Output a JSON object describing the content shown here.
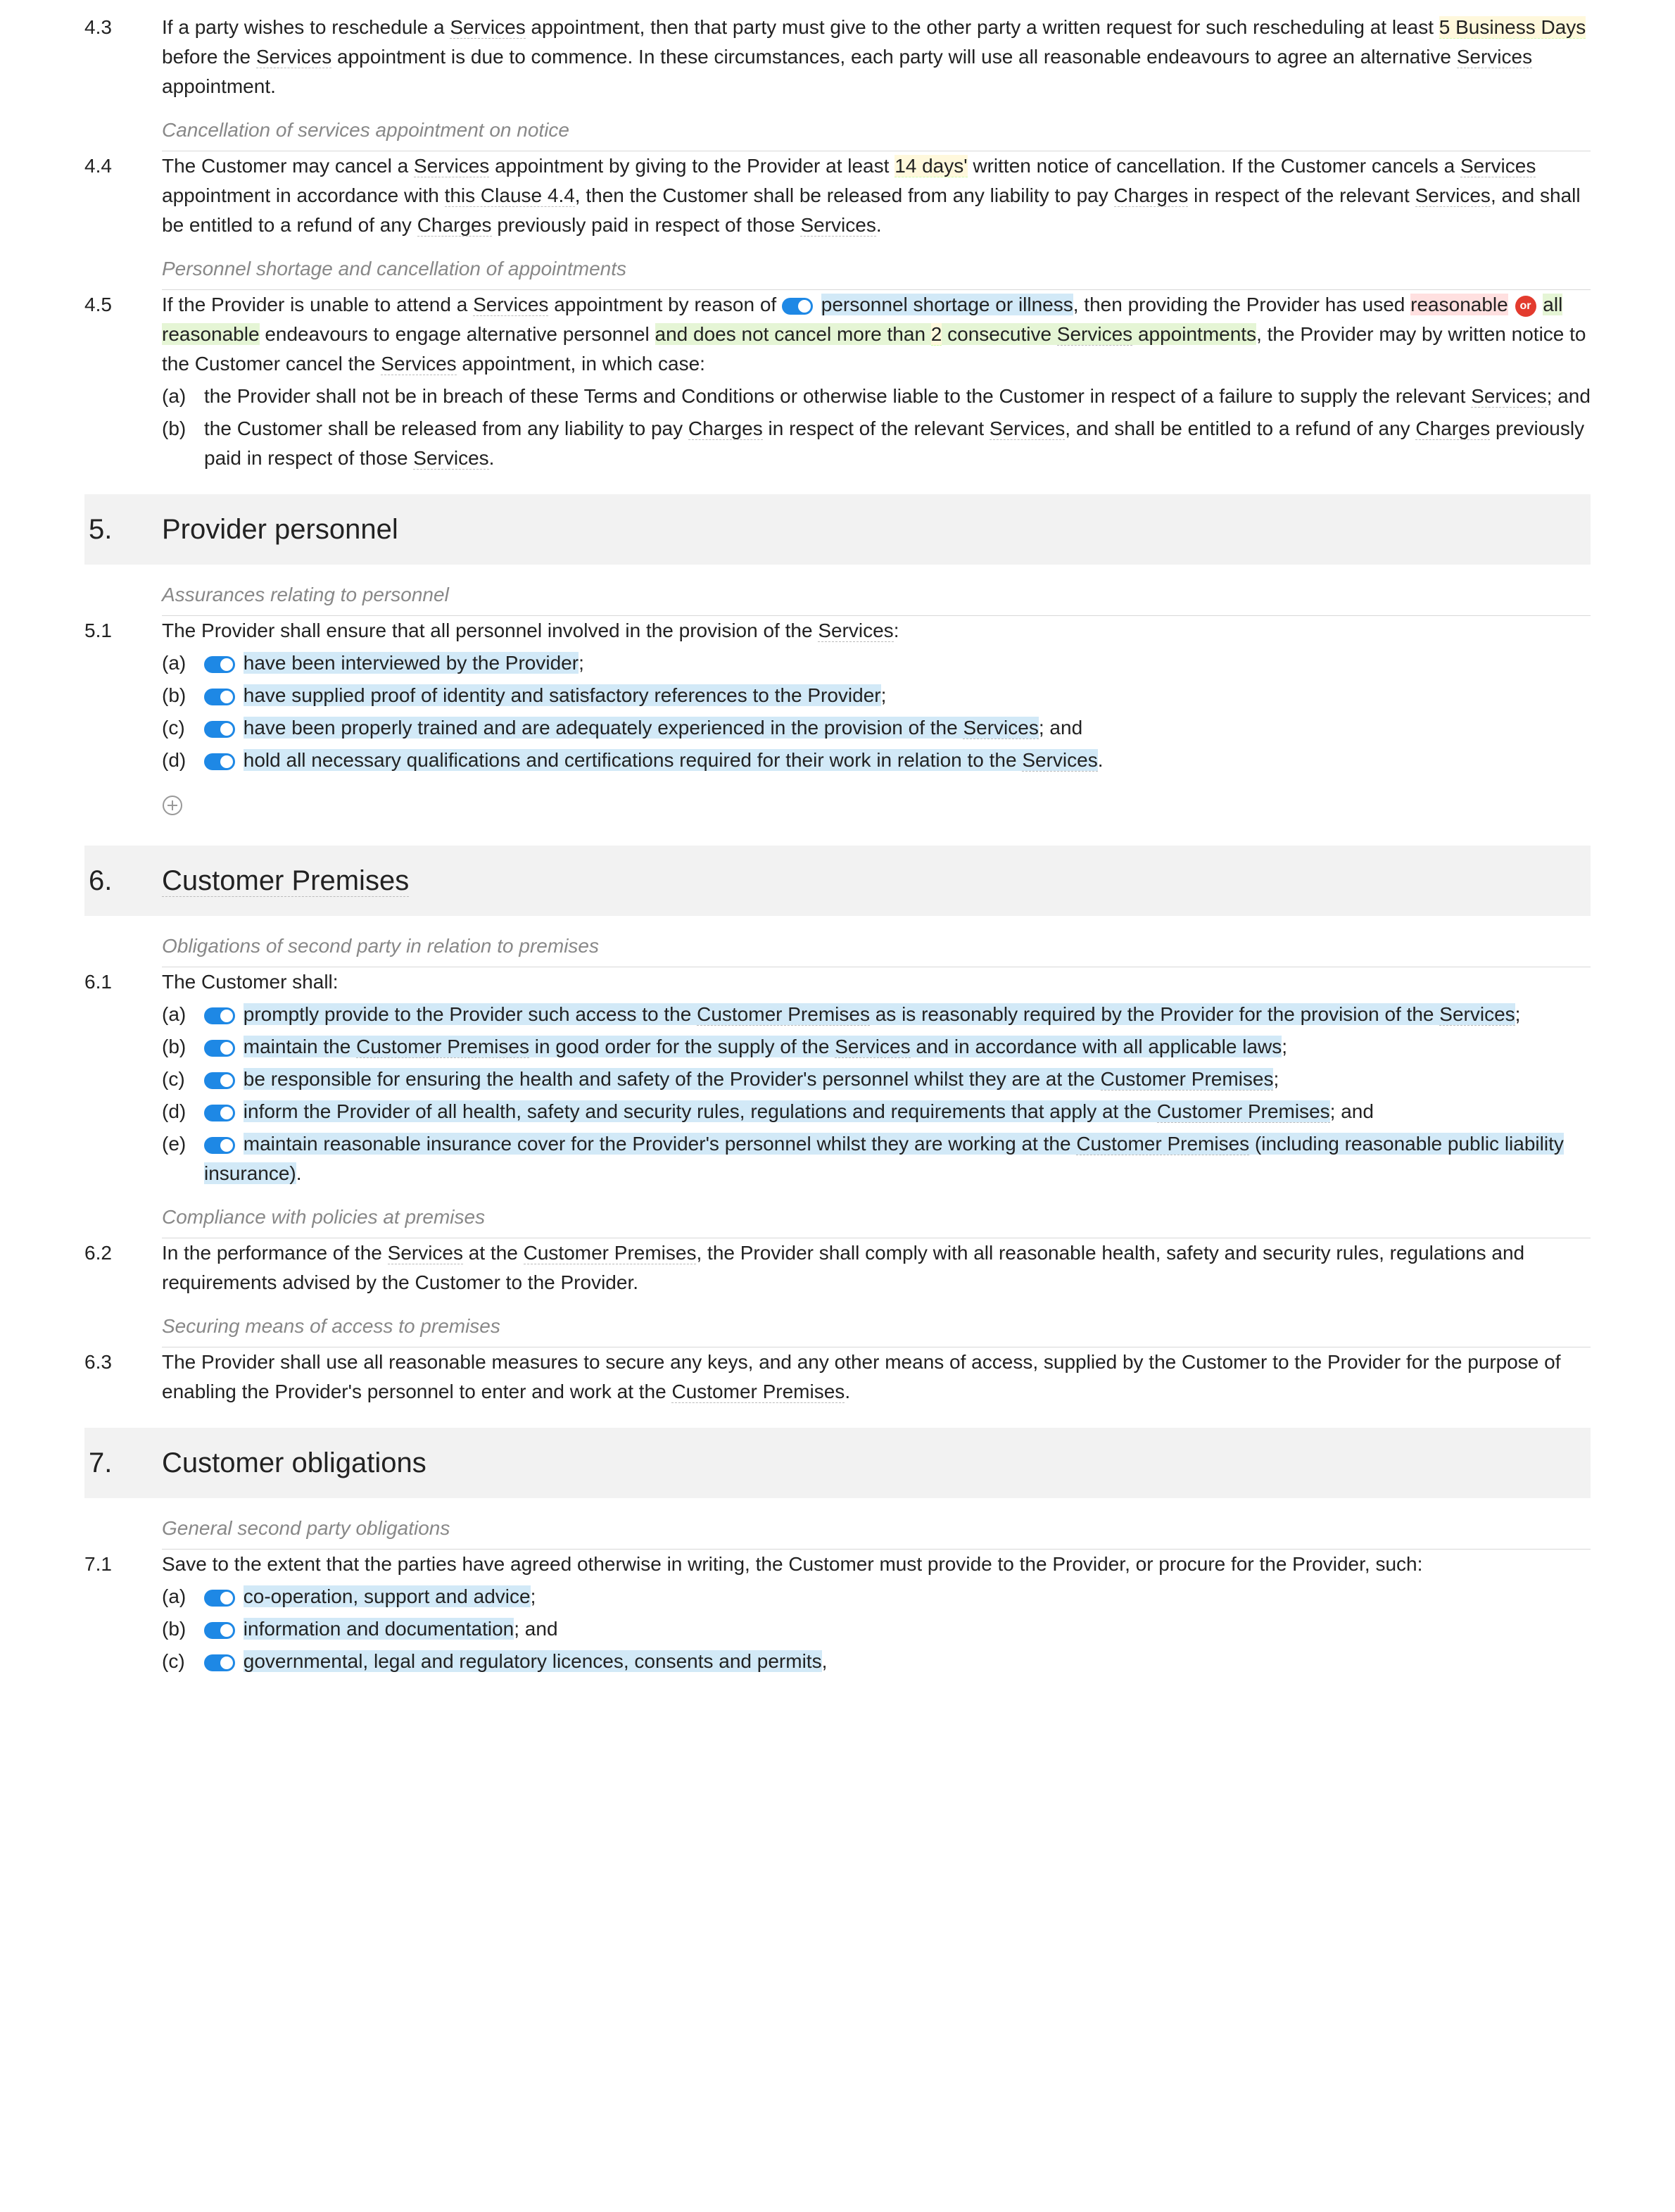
{
  "clauses": {
    "4_3": {
      "num": "4.3",
      "pre": "If a party wishes to reschedule a ",
      "def1": "Services",
      "mid1": " appointment, then that party must give to the other party a written request for such rescheduling at least ",
      "edit1": "5 Business Days",
      "mid2": " before the ",
      "def2": "Services",
      "mid3": " appointment is due to commence. In these circumstances, each party will use all reasonable endeavours to agree an alternative ",
      "def3": "Services",
      "post": " appointment."
    },
    "ann_4_3": "Cancellation of services appointment on notice",
    "4_4": {
      "num": "4.4",
      "t1": "The Customer may cancel a ",
      "d1": "Services",
      "t2": " appointment by giving to the Provider at least ",
      "e1": "14 days'",
      "t3": " written notice of cancellation. If the Customer cancels a ",
      "d2": "Services",
      "t4": " appointment in accordance with ",
      "d3": "this Clause 4.4",
      "t5": ", then the Customer shall be released from any liability to pay ",
      "d4": "Charges",
      "t6": " in respect of the relevant ",
      "d5": "Services",
      "t7": ", and shall be entitled to a refund of any ",
      "d6": "Charges",
      "t8": " previously paid in respect of those ",
      "d7": "Services",
      "t9": "."
    },
    "ann_4_4": "Personnel shortage and cancellation of appointments",
    "4_5": {
      "num": "4.5",
      "t1": "If the Provider is unable to attend a ",
      "d1": "Services",
      "t2": " appointment by reason of ",
      "tog1": "personnel shortage or illness",
      "t3": ", then providing the Provider has used ",
      "opt1a": "reasonable",
      "or": "or",
      "opt1b": "all reasonable",
      "t4": " endeavours to engage alternative personnel ",
      "opt2a": "and does not cancel more than ",
      "opt2b": "2",
      "opt2c": " consecutive ",
      "d2": "Services",
      "opt2d": " appointments",
      "t5": ", the Provider may by written notice to the Customer cancel the ",
      "d3": "Services",
      "t6": " appointment, in which case:",
      "a": {
        "letter": "(a)",
        "t1": "the Provider shall not be in breach of these Terms and Conditions or otherwise liable to the Customer in respect of a failure to supply the relevant ",
        "d1": "Services",
        "t2": "; and"
      },
      "b": {
        "letter": "(b)",
        "t1": "the Customer shall be released from any liability to pay ",
        "d1": "Charges",
        "t2": " in respect of the relevant ",
        "d2": "Services",
        "t3": ", and shall be entitled to a refund of any ",
        "d3": "Charges",
        "t4": " previously paid in respect of those ",
        "d4": "Services",
        "t5": "."
      }
    }
  },
  "section5": {
    "num": "5.",
    "title": "Provider personnel",
    "ann": "Assurances relating to personnel",
    "5_1": {
      "num": "5.1",
      "intro_t1": "The Provider shall ensure that all personnel involved in the provision of the ",
      "intro_d1": "Services",
      "intro_t2": ":",
      "a": {
        "letter": "(a)",
        "t1": "have been interviewed by the Provider",
        "t2": ";"
      },
      "b": {
        "letter": "(b)",
        "t1": "have supplied proof of identity and satisfactory references to the Provider",
        "t2": ";"
      },
      "c": {
        "letter": "(c)",
        "t1": "have been properly trained and are adequately experienced in the provision of the ",
        "d1": "Services",
        "t2": "; and"
      },
      "d": {
        "letter": "(d)",
        "t1": "hold all necessary qualifications and certifications required for their work in relation to the ",
        "d1": "Services",
        "t2": "."
      }
    }
  },
  "section6": {
    "num": "6.",
    "title": "Customer Premises",
    "ann1": "Obligations of second party in relation to premises",
    "6_1": {
      "num": "6.1",
      "intro": "The Customer shall:",
      "a": {
        "letter": "(a)",
        "t1": "promptly provide to the Provider such access to the ",
        "d1": "Customer Premises",
        "t2": " as is reasonably required by the Provider for the provision of the ",
        "d2": "Services",
        "t3": ";"
      },
      "b": {
        "letter": "(b)",
        "t1": "maintain the ",
        "d1": "Customer Premises",
        "t2": " in good order for the supply of the ",
        "d2": "Services",
        "t3": " and in accordance with all applicable laws",
        "t4": ";"
      },
      "c": {
        "letter": "(c)",
        "t1": "be responsible for ensuring the health and safety of the Provider's personnel whilst they are at the ",
        "d1": "Customer Premises",
        "t2": ";"
      },
      "d": {
        "letter": "(d)",
        "t1": "inform the Provider of all health, safety and security rules, regulations and requirements that apply at the ",
        "d1": "Customer Premises",
        "t2": "; and"
      },
      "e": {
        "letter": "(e)",
        "t1": "maintain reasonable insurance cover for the Provider's personnel whilst they are working at the ",
        "d1": "Customer Premises",
        "t2": " (including reasonable public liability insurance)",
        "t3": "."
      }
    },
    "ann2": "Compliance with policies at premises",
    "6_2": {
      "num": "6.2",
      "t1": "In the performance of the ",
      "d1": "Services",
      "t2": " at the ",
      "d2": "Customer Premises",
      "t3": ", the Provider shall comply with all reasonable health, safety and security rules, regulations and requirements advised by the Customer to the Provider."
    },
    "ann3": "Securing means of access to premises",
    "6_3": {
      "num": "6.3",
      "t1": "The Provider shall use all reasonable measures to secure any keys, and any other means of access, supplied by the Customer to the Provider for the purpose of enabling the Provider's personnel to enter and work at the ",
      "d1": "Customer Premises",
      "t2": "."
    }
  },
  "section7": {
    "num": "7.",
    "title": "Customer obligations",
    "ann": "General second party obligations",
    "7_1": {
      "num": "7.1",
      "intro": "Save to the extent that the parties have agreed otherwise in writing, the Customer must provide to the Provider, or procure for the Provider, such:",
      "a": {
        "letter": "(a)",
        "t1": "co-operation, support and advice",
        "t2": ";"
      },
      "b": {
        "letter": "(b)",
        "t1": "information and documentation",
        "t2": "; and"
      },
      "c": {
        "letter": "(c)",
        "t1": "governmental, legal and regulatory licences, consents and permits",
        "t2": ","
      }
    }
  }
}
